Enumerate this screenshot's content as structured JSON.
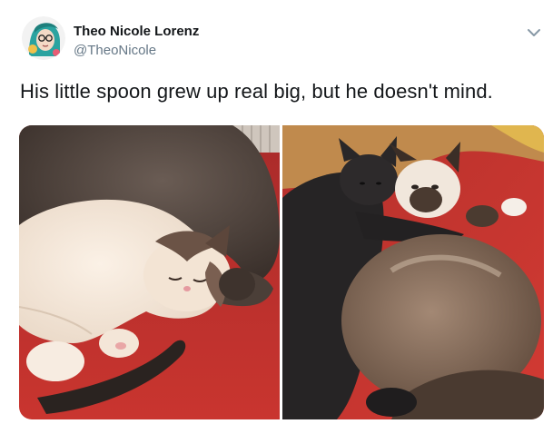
{
  "author": {
    "display_name": "Theo Nicole Lorenz",
    "handle": "@TheoNicole",
    "avatar_icon": "profile-avatar"
  },
  "tweet": {
    "text": "His little spoon grew up real big, but he doesn't mind."
  },
  "menu": {
    "icon": "chevron-down-icon"
  },
  "media": [
    {
      "icon": "photo-two-cats-sleeping-on-red-couch"
    },
    {
      "icon": "photo-black-cat-cuddling-siamese-cat"
    }
  ],
  "colors": {
    "text_primary": "#14171a",
    "text_secondary": "#657786",
    "chevron": "#8899a6",
    "couch_red": "#c8302c"
  }
}
